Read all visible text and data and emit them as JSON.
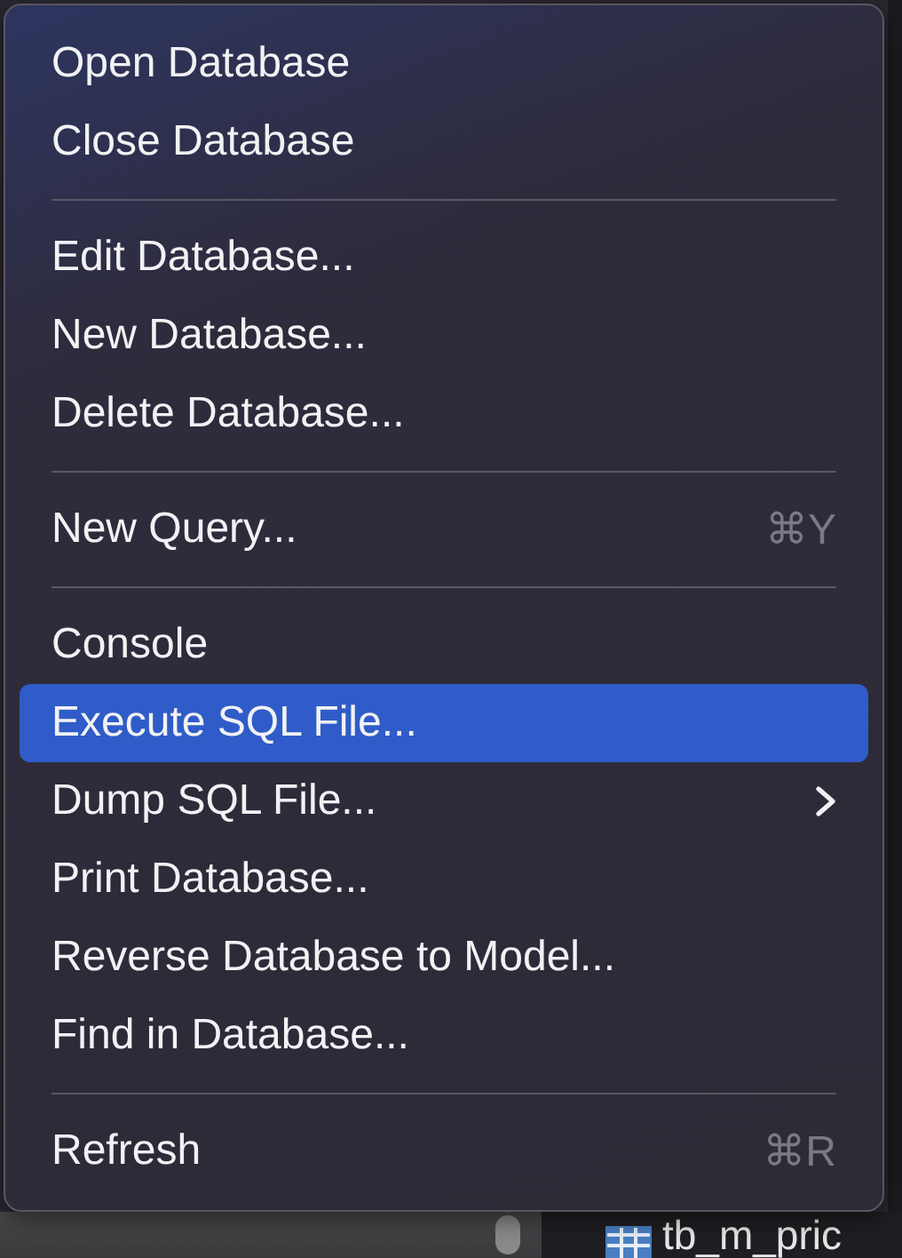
{
  "menu": {
    "sections": [
      [
        {
          "label": "Open Database",
          "submenu": false,
          "selected": false
        },
        {
          "label": "Close Database",
          "submenu": false,
          "selected": false
        }
      ],
      [
        {
          "label": "Edit Database...",
          "submenu": false,
          "selected": false
        },
        {
          "label": "New Database...",
          "submenu": false,
          "selected": false
        },
        {
          "label": "Delete Database...",
          "submenu": false,
          "selected": false
        }
      ],
      [
        {
          "label": "New Query...",
          "shortcut": "⌘Y",
          "submenu": false,
          "selected": false
        }
      ],
      [
        {
          "label": "Console",
          "submenu": false,
          "selected": false
        },
        {
          "label": "Execute SQL File...",
          "submenu": false,
          "selected": true
        },
        {
          "label": "Dump SQL File...",
          "submenu": true,
          "selected": false
        },
        {
          "label": "Print Database...",
          "submenu": false,
          "selected": false
        },
        {
          "label": "Reverse Database to Model...",
          "submenu": false,
          "selected": false
        },
        {
          "label": "Find in Database...",
          "submenu": false,
          "selected": false
        }
      ],
      [
        {
          "label": "Refresh",
          "shortcut": "⌘R",
          "submenu": false,
          "selected": false
        }
      ]
    ]
  },
  "background": {
    "table_label": "tb_m_pric"
  }
}
